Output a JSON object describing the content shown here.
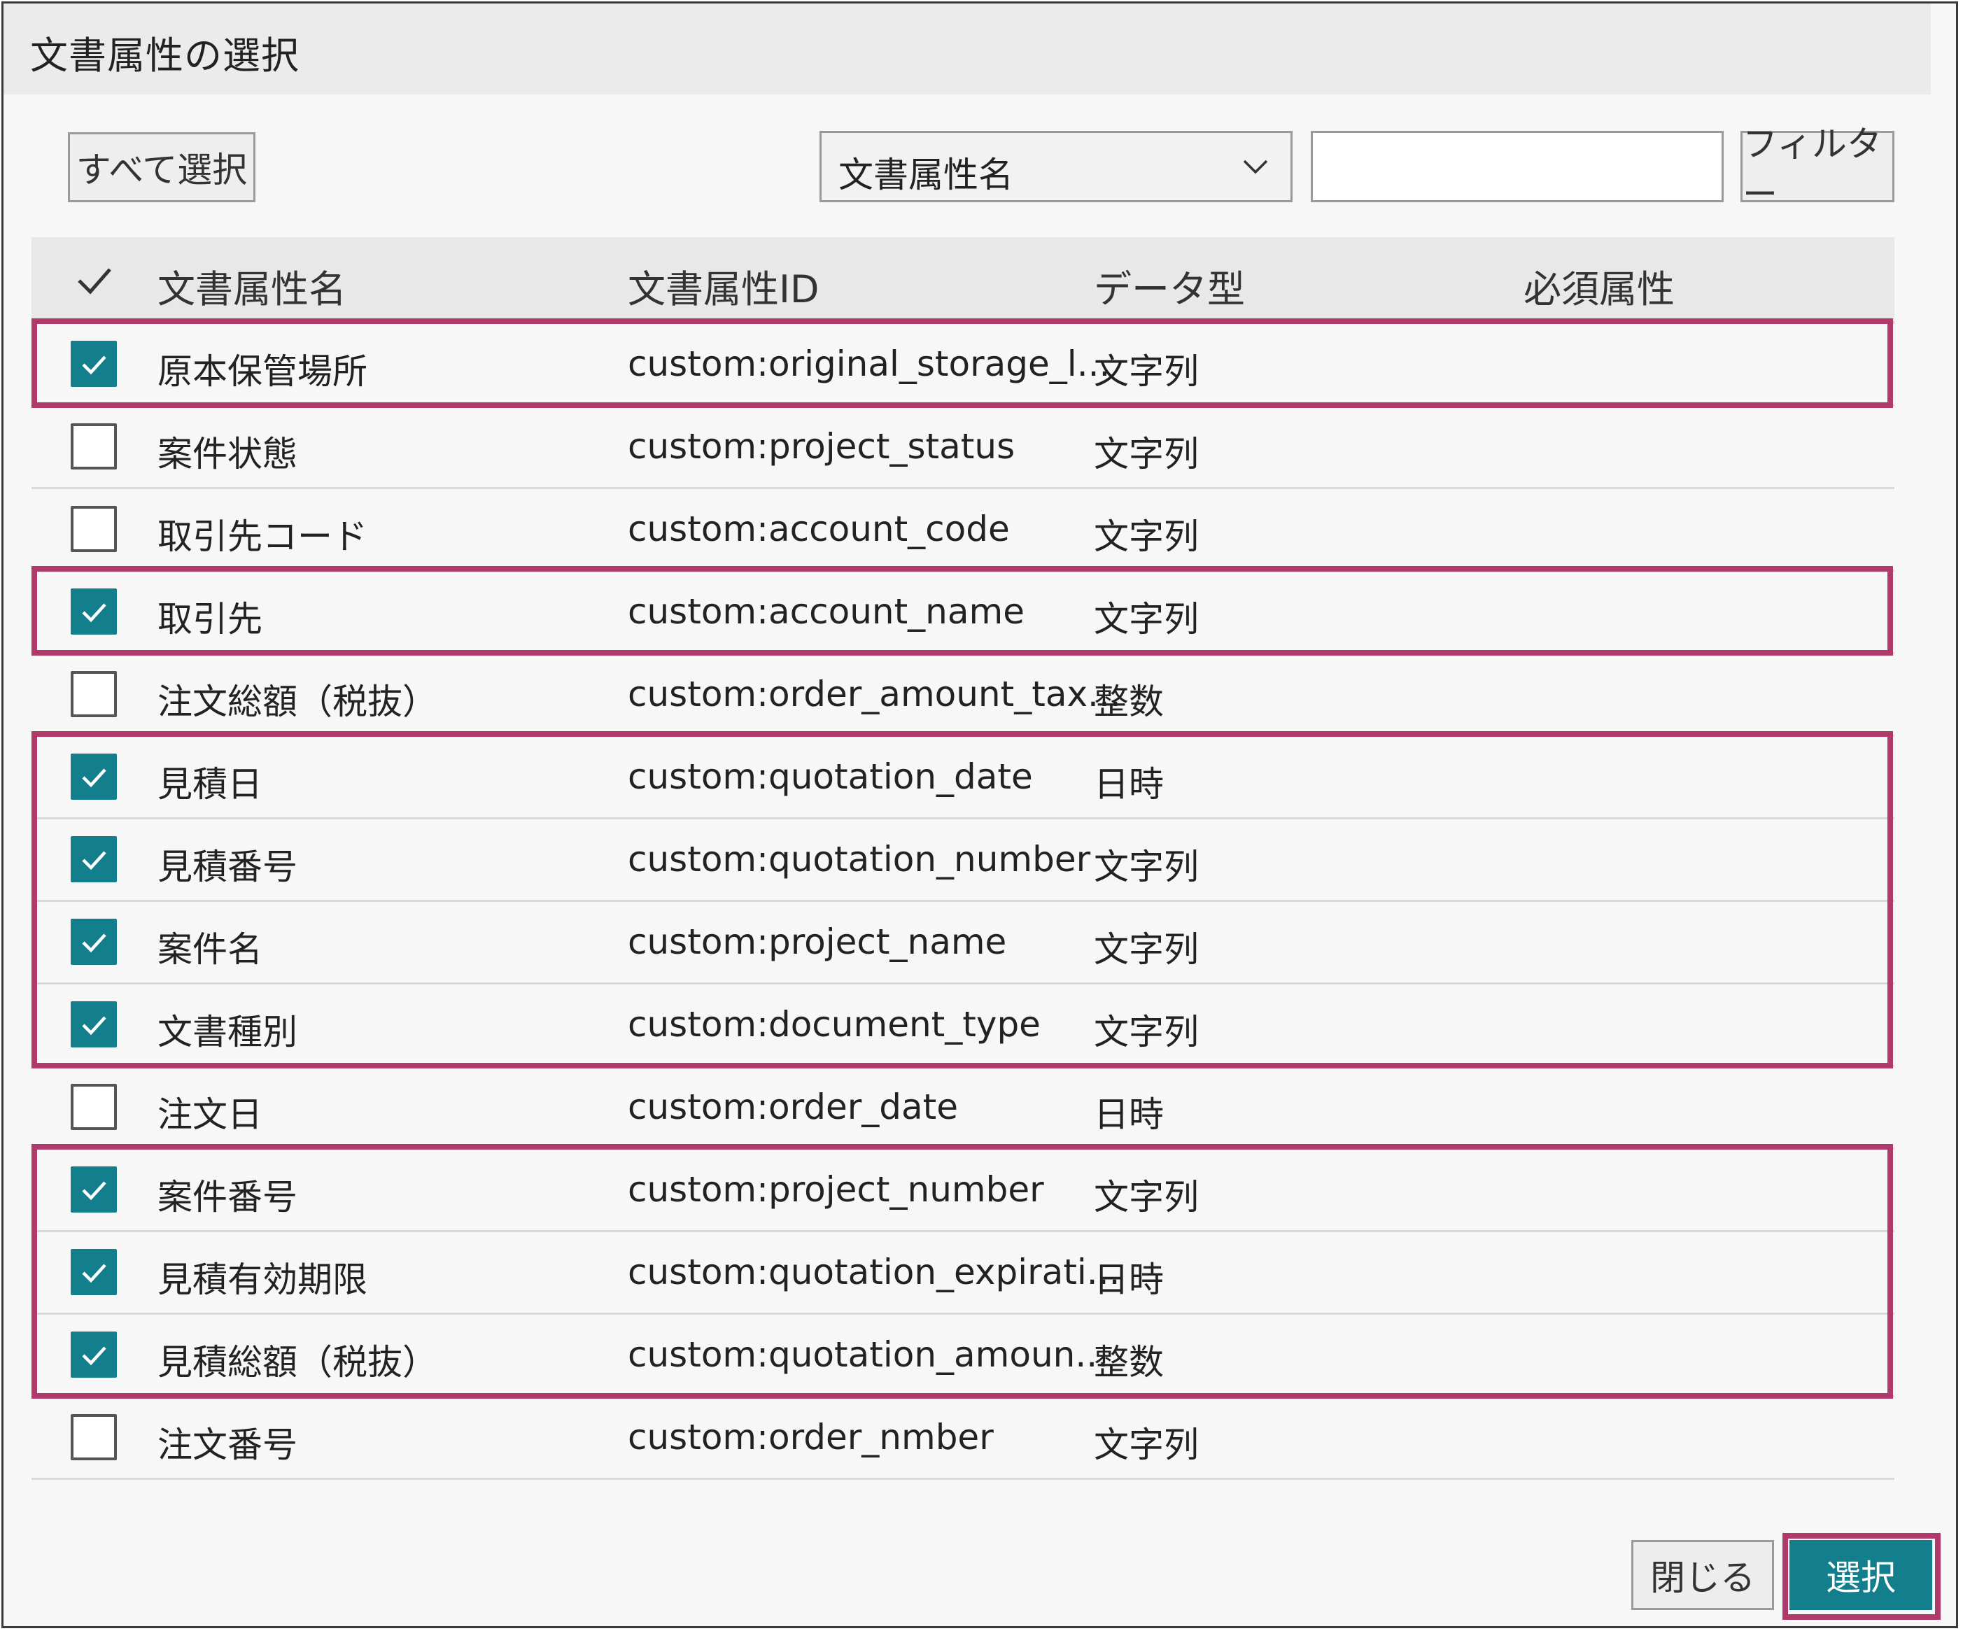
{
  "dialog": {
    "title": "文書属性の選択",
    "select_all_label": "すべて選択",
    "filter_field_selected": "文書属性名",
    "filter_input_value": "",
    "filter_button_label": "フィルター",
    "close_button_label": "閉じる",
    "select_button_label": "選択"
  },
  "colors": {
    "accent": "#137e8c",
    "highlight": "#b03a6c"
  },
  "table": {
    "headers": {
      "name": "文書属性名",
      "id": "文書属性ID",
      "type": "データ型",
      "required": "必須属性"
    },
    "rows": [
      {
        "checked": true,
        "name": "原本保管場所",
        "id": "custom:original_storage_l...",
        "type": "文字列",
        "required": ""
      },
      {
        "checked": false,
        "name": "案件状態",
        "id": "custom:project_status",
        "type": "文字列",
        "required": ""
      },
      {
        "checked": false,
        "name": "取引先コード",
        "id": "custom:account_code",
        "type": "文字列",
        "required": ""
      },
      {
        "checked": true,
        "name": "取引先",
        "id": "custom:account_name",
        "type": "文字列",
        "required": ""
      },
      {
        "checked": false,
        "name": "注文総額（税抜）",
        "id": "custom:order_amount_tax...",
        "type": "整数",
        "required": ""
      },
      {
        "checked": true,
        "name": "見積日",
        "id": "custom:quotation_date",
        "type": "日時",
        "required": ""
      },
      {
        "checked": true,
        "name": "見積番号",
        "id": "custom:quotation_number",
        "type": "文字列",
        "required": ""
      },
      {
        "checked": true,
        "name": "案件名",
        "id": "custom:project_name",
        "type": "文字列",
        "required": ""
      },
      {
        "checked": true,
        "name": "文書種別",
        "id": "custom:document_type",
        "type": "文字列",
        "required": ""
      },
      {
        "checked": false,
        "name": "注文日",
        "id": "custom:order_date",
        "type": "日時",
        "required": ""
      },
      {
        "checked": true,
        "name": "案件番号",
        "id": "custom:project_number",
        "type": "文字列",
        "required": ""
      },
      {
        "checked": true,
        "name": "見積有効期限",
        "id": "custom:quotation_expirati...",
        "type": "日時",
        "required": ""
      },
      {
        "checked": true,
        "name": "見積総額（税抜）",
        "id": "custom:quotation_amoun...",
        "type": "整数",
        "required": ""
      },
      {
        "checked": false,
        "name": "注文番号",
        "id": "custom:order_nmber",
        "type": "文字列",
        "required": ""
      }
    ]
  }
}
